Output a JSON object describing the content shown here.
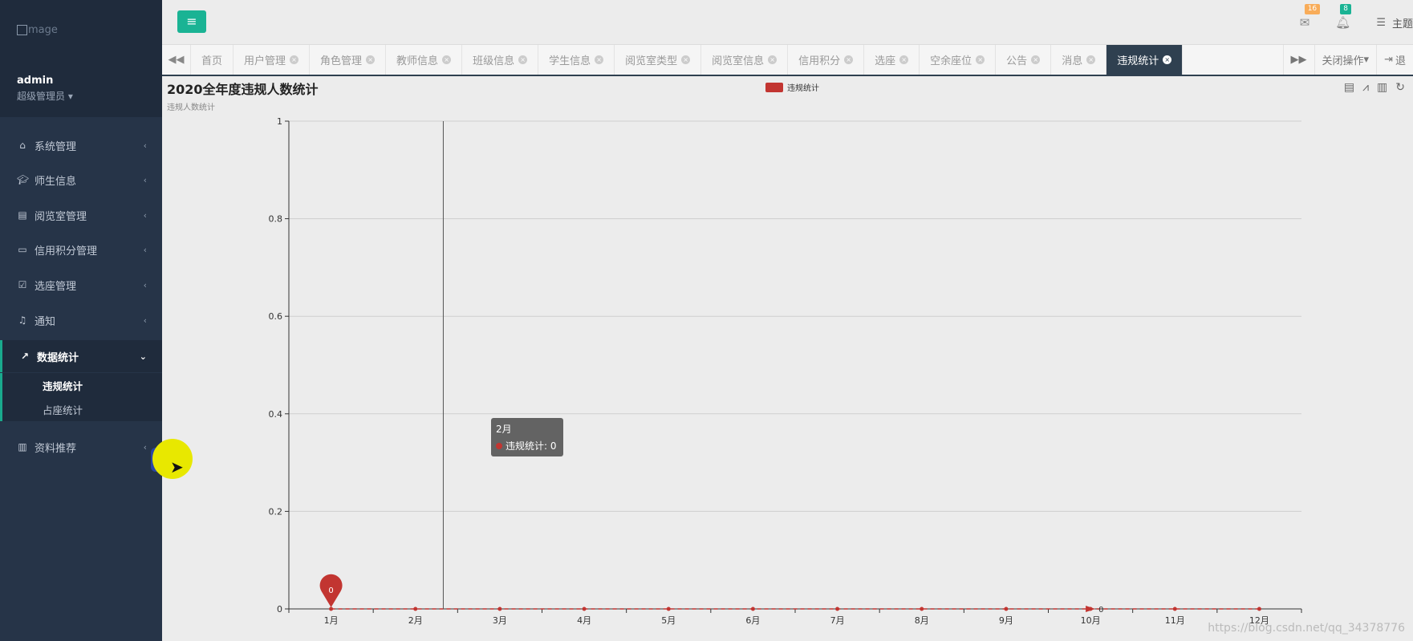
{
  "sidebar": {
    "logo_alt": "mage",
    "username": "admin",
    "role": "超级管理员",
    "items": [
      {
        "label": "系统管理",
        "icon": "home-icon"
      },
      {
        "label": "师生信息",
        "icon": "graduation-cap-icon"
      },
      {
        "label": "阅览室管理",
        "icon": "book-icon"
      },
      {
        "label": "信用积分管理",
        "icon": "credit-card-icon"
      },
      {
        "label": "选座管理",
        "icon": "calendar-check-icon"
      },
      {
        "label": "通知",
        "icon": "bell-icon"
      },
      {
        "label": "数据统计",
        "icon": "line-chart-icon"
      },
      {
        "label": "资料推荐",
        "icon": "book-icon"
      }
    ],
    "subitems": [
      {
        "label": "违规统计"
      },
      {
        "label": "占座统计"
      }
    ]
  },
  "topbar": {
    "mail_badge": "16",
    "mail_badge_color": "#f8ac59",
    "bell_badge": "8",
    "bell_badge_color": "#1ab394",
    "theme_label": "主题"
  },
  "tabbar": {
    "tabs": [
      {
        "label": "首页"
      },
      {
        "label": "用户管理"
      },
      {
        "label": "角色管理"
      },
      {
        "label": "教师信息"
      },
      {
        "label": "班级信息"
      },
      {
        "label": "学生信息"
      },
      {
        "label": "阅览室类型"
      },
      {
        "label": "阅览室信息"
      },
      {
        "label": "信用积分"
      },
      {
        "label": "选座"
      },
      {
        "label": "空余座位"
      },
      {
        "label": "公告"
      },
      {
        "label": "消息"
      },
      {
        "label": "违规统计"
      }
    ],
    "close_ops_label": "关闭操作",
    "logout_label": "退"
  },
  "tooltip": {
    "title": "2月",
    "series_label": "违规统计",
    "value": "0"
  },
  "watermark": "https://blog.csdn.net/qq_34378776",
  "colors": {
    "sidebar_bg": "#263448",
    "accent_green": "#1ab394",
    "series_red": "#c23531",
    "active_tab": "#2f4050"
  },
  "chart_data": {
    "type": "line",
    "title": "2020全年度违规人数统计",
    "subtitle": "违规人数统计",
    "legend": [
      "违规统计"
    ],
    "legend_position": "top-center",
    "categories": [
      "1月",
      "2月",
      "3月",
      "4月",
      "5月",
      "6月",
      "7月",
      "8月",
      "9月",
      "10月",
      "11月",
      "12月"
    ],
    "series": [
      {
        "name": "违规统计",
        "values": [
          0,
          0,
          0,
          0,
          0,
          0,
          0,
          0,
          0,
          0,
          0,
          0
        ],
        "color": "#c23531",
        "line_style": "dashed"
      }
    ],
    "ylim": [
      0,
      1
    ],
    "yticks": [
      "0",
      "0.2",
      "0.4",
      "0.6",
      "0.8",
      "1"
    ],
    "markpoint": {
      "category": "1月",
      "value": 0,
      "label": "0"
    },
    "end_label": {
      "category": "10月",
      "label": "0"
    },
    "grid": true
  }
}
